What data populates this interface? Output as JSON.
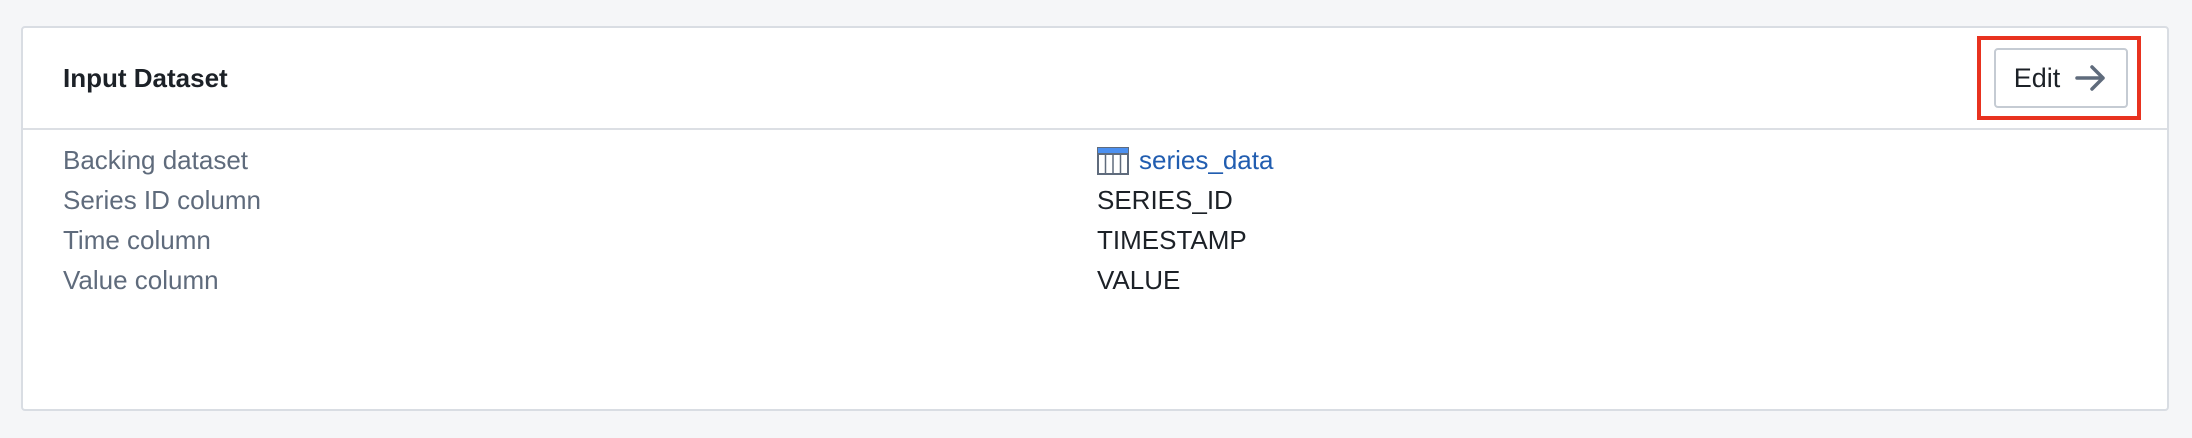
{
  "card": {
    "title": "Input Dataset",
    "edit_label": "Edit",
    "edit_icon": "arrow-right-icon"
  },
  "properties": [
    {
      "label": "Backing dataset",
      "value": "series_data",
      "icon": "table-icon",
      "is_link": true
    },
    {
      "label": "Series ID column",
      "value": "SERIES_ID"
    },
    {
      "label": "Time column",
      "value": "TIMESTAMP"
    },
    {
      "label": "Value column",
      "value": "VALUE"
    }
  ],
  "colors": {
    "highlight": "#e8321f",
    "link": "#215db0",
    "label": "#5f6b7c"
  }
}
